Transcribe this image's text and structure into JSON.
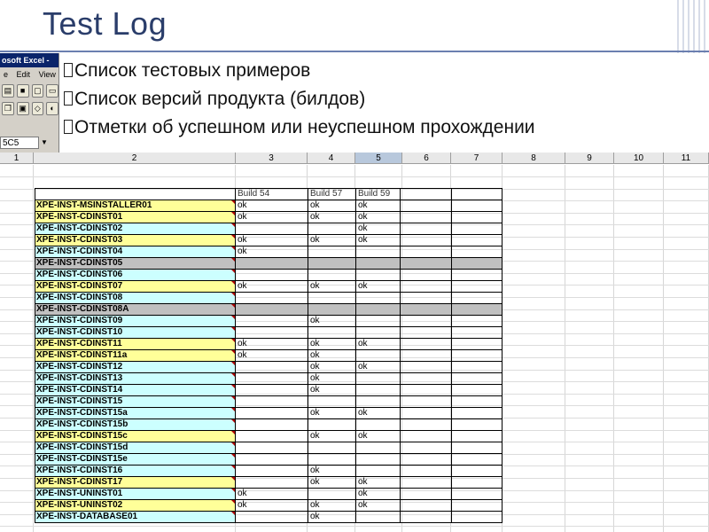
{
  "slide": {
    "title": "Test Log",
    "bullets": [
      "Список тестовых примеров",
      "Список версий продукта (билдов)",
      "Отметки об успешном или неуспешном прохождении"
    ]
  },
  "excel": {
    "window_title": "osoft Excel -",
    "menu": [
      "e",
      "Edit",
      "View"
    ],
    "name_box": "5C5",
    "toolbar_icons": [
      "open-icon",
      "save-icon",
      "print-preview-icon",
      "print-icon",
      "copy-icon",
      "paste-icon",
      "clear-icon",
      "format-icon"
    ]
  },
  "sheet": {
    "columns": [
      "1",
      "2",
      "3",
      "4",
      "5",
      "6",
      "7",
      "8",
      "9",
      "10",
      "11"
    ],
    "selected_column": "5",
    "header_row": [
      "",
      "Build 54",
      "Build 57",
      "Build 59"
    ],
    "rows": [
      {
        "name": "XPE-INST-MSINSTALLER01",
        "color": "yellow",
        "b54": "ok",
        "b57": "ok",
        "b59": "ok"
      },
      {
        "name": "XPE-INST-CDINST01",
        "color": "yellow",
        "b54": "ok",
        "b57": "ok",
        "b59": "ok"
      },
      {
        "name": "XPE-INST-CDINST02",
        "color": "cyan",
        "b54": "",
        "b57": "",
        "b59": "ok"
      },
      {
        "name": "XPE-INST-CDINST03",
        "color": "yellow",
        "b54": "ok",
        "b57": "ok",
        "b59": "ok"
      },
      {
        "name": "XPE-INST-CDINST04",
        "color": "cyan",
        "b54": "ok",
        "b57": "",
        "b59": ""
      },
      {
        "name": "XPE-INST-CDINST05",
        "color": "gray",
        "b54": "",
        "b57": "",
        "b59": ""
      },
      {
        "name": "XPE-INST-CDINST06",
        "color": "cyan",
        "b54": "",
        "b57": "",
        "b59": ""
      },
      {
        "name": "XPE-INST-CDINST07",
        "color": "yellow",
        "b54": "ok",
        "b57": "ok",
        "b59": "ok"
      },
      {
        "name": "XPE-INST-CDINST08",
        "color": "cyan",
        "b54": "",
        "b57": "",
        "b59": ""
      },
      {
        "name": "XPE-INST-CDINST08A",
        "color": "gray",
        "b54": "",
        "b57": "",
        "b59": ""
      },
      {
        "name": "XPE-INST-CDINST09",
        "color": "cyan",
        "b54": "",
        "b57": "ok",
        "b59": ""
      },
      {
        "name": "XPE-INST-CDINST10",
        "color": "cyan",
        "b54": "",
        "b57": "",
        "b59": ""
      },
      {
        "name": "XPE-INST-CDINST11",
        "color": "yellow",
        "b54": "ok",
        "b57": "ok",
        "b59": "ok"
      },
      {
        "name": "XPE-INST-CDINST11a",
        "color": "yellow",
        "b54": "ok",
        "b57": "ok",
        "b59": ""
      },
      {
        "name": "XPE-INST-CDINST12",
        "color": "cyan",
        "b54": "",
        "b57": "ok",
        "b59": "ok"
      },
      {
        "name": "XPE-INST-CDINST13",
        "color": "cyan",
        "b54": "",
        "b57": "ok",
        "b59": ""
      },
      {
        "name": "XPE-INST-CDINST14",
        "color": "cyan",
        "b54": "",
        "b57": "ok",
        "b59": ""
      },
      {
        "name": "XPE-INST-CDINST15",
        "color": "cyan",
        "b54": "",
        "b57": "",
        "b59": ""
      },
      {
        "name": "XPE-INST-CDINST15a",
        "color": "cyan",
        "b54": "",
        "b57": "ok",
        "b59": "ok"
      },
      {
        "name": "XPE-INST-CDINST15b",
        "color": "cyan",
        "b54": "",
        "b57": "",
        "b59": ""
      },
      {
        "name": "XPE-INST-CDINST15c",
        "color": "yellow",
        "b54": "",
        "b57": "ok",
        "b59": "ok"
      },
      {
        "name": "XPE-INST-CDINST15d",
        "color": "cyan",
        "b54": "",
        "b57": "",
        "b59": ""
      },
      {
        "name": "XPE-INST-CDINST15e",
        "color": "cyan",
        "b54": "",
        "b57": "",
        "b59": ""
      },
      {
        "name": "XPE-INST-CDINST16",
        "color": "cyan",
        "b54": "",
        "b57": "ok",
        "b59": ""
      },
      {
        "name": "XPE-INST-CDINST17",
        "color": "yellow",
        "b54": "",
        "b57": "ok",
        "b59": "ok"
      },
      {
        "name": "XPE-INST-UNINST01",
        "color": "cyan",
        "b54": "ok",
        "b57": "",
        "b59": "ok"
      },
      {
        "name": "XPE-INST-UNINST02",
        "color": "yellow",
        "b54": "ok",
        "b57": "ok",
        "b59": "ok"
      },
      {
        "name": "XPE-INST-DATABASE01",
        "color": "cyan",
        "b54": "",
        "b57": "ok",
        "b59": ""
      }
    ]
  }
}
